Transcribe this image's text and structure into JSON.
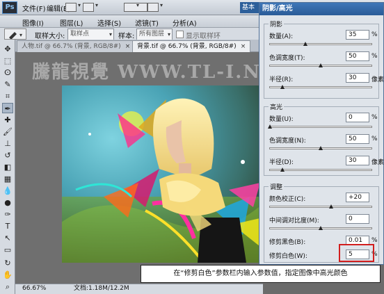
{
  "menubar": {
    "logo": "Ps",
    "items": [
      "文件(F)",
      "编辑(E)",
      "图像(I)",
      "图层(L)",
      "选择(S)",
      "滤镜(T)",
      "分析(A)"
    ],
    "workspace": "基本"
  },
  "options": {
    "sample_size_label": "取样大小:",
    "sample_size_value": "取样点",
    "sample_label": "样本:",
    "sample_value": "所有图层",
    "show_ring_label": "显示取样环"
  },
  "tabs": [
    {
      "label": "人物.tif @ 66.7% (背景, RGB/8#)",
      "close": "×"
    },
    {
      "label": "背景.tif @ 66.7% (背景, RGB/8#)",
      "close": "×"
    }
  ],
  "canvas": {
    "watermark": "騰龍視覺 WWW.TL-I.NET"
  },
  "status": {
    "zoom": "66.67%",
    "doc_info": "文档:1.18M/12.2M"
  },
  "dialog": {
    "title": "阴影/高光",
    "groups": [
      {
        "title": "阴影",
        "rows": [
          {
            "label": "数量(A):",
            "value": "35",
            "unit": "%",
            "slider": 0.35
          },
          {
            "label": "色调宽度(T):",
            "value": "50",
            "unit": "%",
            "slider": 0.5
          },
          {
            "label": "半径(R):",
            "value": "30",
            "unit": "像素",
            "slider": 0.12
          }
        ]
      },
      {
        "title": "高光",
        "rows": [
          {
            "label": "数量(U):",
            "value": "0",
            "unit": "%",
            "slider": 0.0
          },
          {
            "label": "色调宽度(N):",
            "value": "50",
            "unit": "%",
            "slider": 0.5
          },
          {
            "label": "半径(D):",
            "value": "30",
            "unit": "像素",
            "slider": 0.12
          }
        ]
      },
      {
        "title": "调整",
        "rows": [
          {
            "label": "颜色校正(C):",
            "value": "+20",
            "unit": "",
            "slider": 0.6
          },
          {
            "label": "中间调对比度(M):",
            "value": "0",
            "unit": "",
            "slider": 0.5
          },
          {
            "label": "修剪黑色(B):",
            "value": "0.01",
            "unit": "%",
            "slider": 0.0
          },
          {
            "label": "修剪白色(W):",
            "value": "5",
            "unit": "%",
            "slider": null
          }
        ]
      }
    ]
  },
  "caption": "在“修剪白色”参数栏内输入参数值，指定图像中高光颜色",
  "colors": {
    "highlight": "#d21e1e",
    "dialog_title": "#2a5b97"
  }
}
